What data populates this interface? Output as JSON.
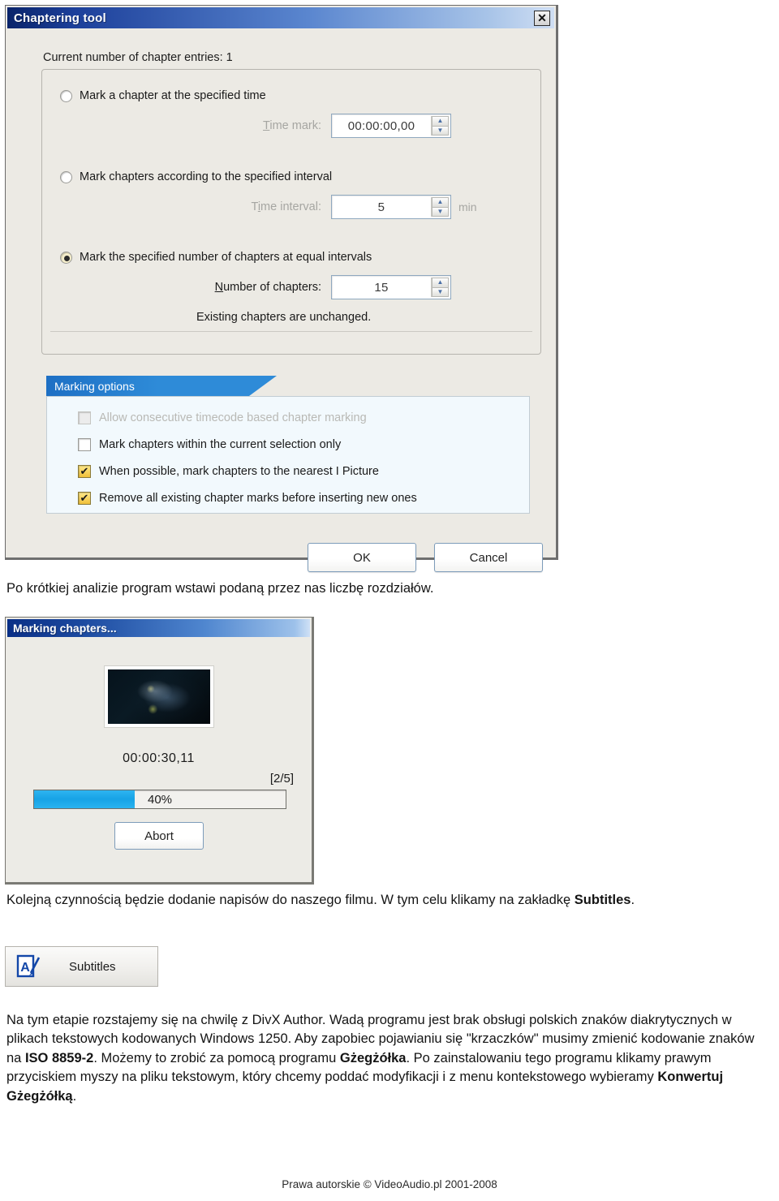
{
  "chapter_dialog": {
    "title": "Chaptering tool",
    "close_icon": "✕",
    "entries_line": "Current number of chapter entries: 1",
    "options": [
      {
        "id": "specified-time",
        "label": "Mark a chapter at the specified time",
        "selected": false,
        "field_label": "Time mark:",
        "field_value": "00:00:00,00",
        "unit": ""
      },
      {
        "id": "specified-interval",
        "label": "Mark chapters according to the specified interval",
        "selected": false,
        "field_label": "Time interval:",
        "field_value": "5",
        "unit": "min"
      },
      {
        "id": "equal-intervals",
        "label": "Mark the specified number of chapters at equal intervals",
        "selected": true,
        "field_label": "Number of chapters:",
        "field_value": "15",
        "unit": ""
      }
    ],
    "note": "Existing chapters are unchanged.",
    "marking_options": {
      "header": "Marking options",
      "checkboxes": [
        {
          "label": "Allow consecutive timecode based chapter marking",
          "checked": false,
          "disabled": true
        },
        {
          "label": "Mark chapters within the current selection only",
          "checked": false,
          "disabled": false
        },
        {
          "label": "When possible, mark chapters to the nearest I Picture",
          "checked": true,
          "disabled": false
        },
        {
          "label": "Remove all existing chapter marks before inserting new ones",
          "checked": true,
          "disabled": false
        }
      ]
    },
    "ok_label": "OK",
    "cancel_label": "Cancel",
    "spin_up_icon": "▲",
    "spin_down_icon": "▼"
  },
  "paragraph_1": "Po krótkiej analizie program wstawi podaną przez nas liczbę rozdziałów.",
  "progress_dialog": {
    "title": "Marking chapters...",
    "timecode": "00:00:30,11",
    "counter": "[2/5]",
    "percent_label": "40%",
    "percent_value": 40,
    "abort_label": "Abort"
  },
  "paragraph_2": {
    "part1": "Kolejną czynnością będzie dodanie napisów do naszego filmu. W tym celu klikamy na zakładkę ",
    "bold1": "Subtitles",
    "part2": "."
  },
  "subtitles_button": {
    "label": "Subtitles",
    "icon": "subtitles-edit-icon"
  },
  "paragraph_3": {
    "part1": "Na tym etapie rozstajemy się na chwilę z DivX Author. Wadą programu jest brak obsługi polskich znaków diakrytycznych w plikach tekstowych kodowanych Windows 1250. Aby zapobiec pojawianiu się \"krzaczków\" musimy zmienić kodowanie znaków na ",
    "bold1": "ISO 8859-2",
    "part2": ". Możemy to zrobić za pomocą programu ",
    "bold2": "Gżegżółka",
    "part3": ". Po zainstalowaniu tego programu klikamy prawym przyciskiem myszy na pliku tekstowym, który chcemy poddać modyfikacji i z menu kontekstowego wybieramy ",
    "bold3": "Konwertuj Gżegżółką",
    "part4": "."
  },
  "footer": "Prawa autorskie © VideoAudio.pl 2001-2008",
  "colors": {
    "titlebar_dark": "#0a246a",
    "banner_blue": "#2e8bd8",
    "progress_fill": "#17a3e6",
    "checkbox_checked": "#f0c03a",
    "dialog_face": "#eceae4"
  }
}
